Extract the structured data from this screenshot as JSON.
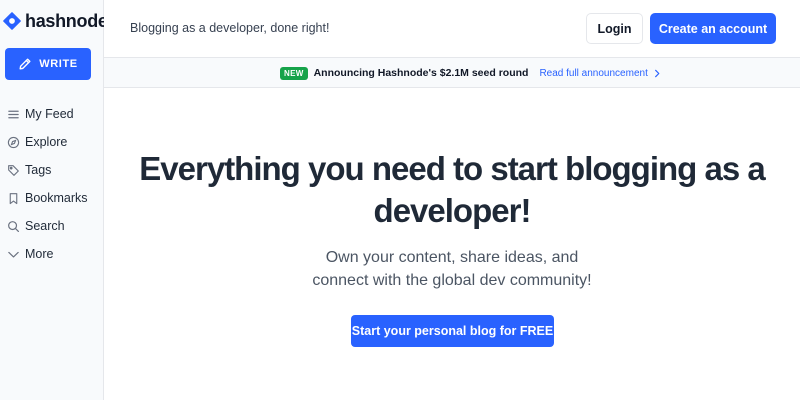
{
  "brand": {
    "name": "hashnode",
    "accent": "#2962ff"
  },
  "sidebar": {
    "write_label": "WRITE",
    "items": [
      {
        "label": "My Feed",
        "icon": "feed-lines-icon"
      },
      {
        "label": "Explore",
        "icon": "compass-icon"
      },
      {
        "label": "Tags",
        "icon": "tag-icon"
      },
      {
        "label": "Bookmarks",
        "icon": "bookmark-icon"
      },
      {
        "label": "Search",
        "icon": "search-icon"
      },
      {
        "label": "More",
        "icon": "chevron-down-icon"
      }
    ]
  },
  "header": {
    "tagline": "Blogging as a developer, done right!",
    "login_label": "Login",
    "create_label": "Create an account"
  },
  "announcement": {
    "badge": "NEW",
    "text": "Announcing Hashnode's $2.1M seed round",
    "link": "Read full announcement",
    "badge_color": "#16a34a"
  },
  "hero": {
    "title_line1": "Everything you need to start blogging as a",
    "title_line2": "developer!",
    "subtitle_line1": "Own your content, share ideas, and",
    "subtitle_line2": "connect with the global dev community!",
    "cta_label": "Start your personal blog for FREE"
  }
}
